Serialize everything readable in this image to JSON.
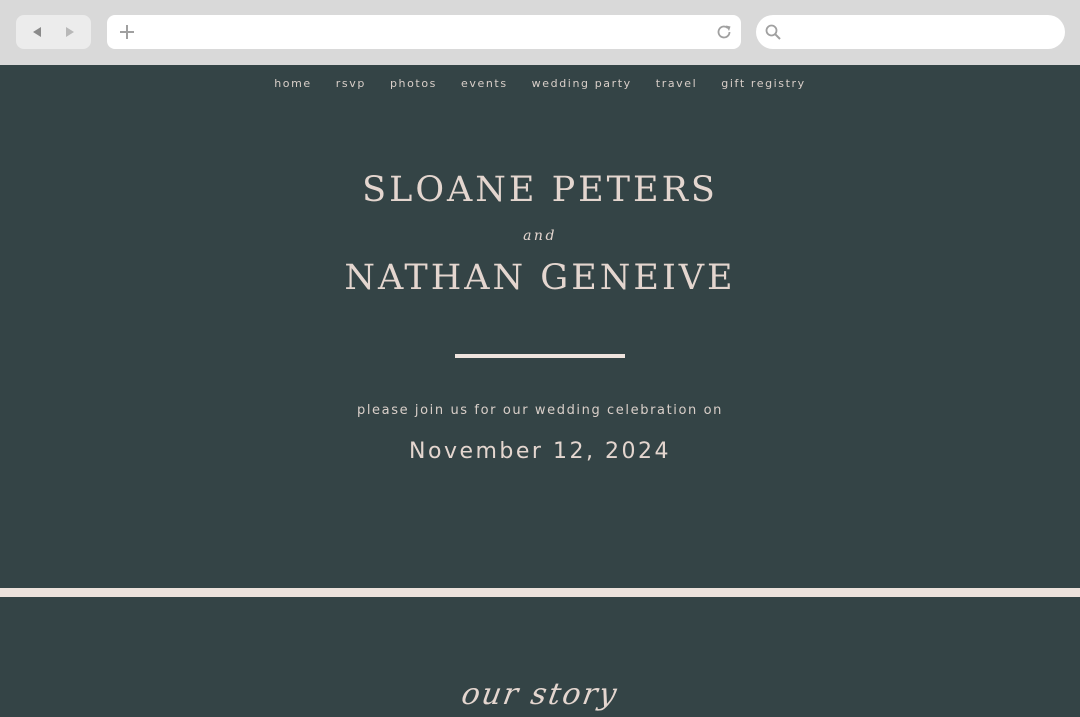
{
  "browser": {
    "back_icon": "triangle-left-icon",
    "forward_icon": "triangle-right-icon",
    "new_tab_icon": "plus-icon",
    "reload_icon": "reload-icon",
    "search_icon": "search-icon"
  },
  "site_nav": {
    "items": [
      {
        "label": "home"
      },
      {
        "label": "rsvp"
      },
      {
        "label": "photos"
      },
      {
        "label": "events"
      },
      {
        "label": "wedding party"
      },
      {
        "label": "travel"
      },
      {
        "label": "gift registry"
      }
    ]
  },
  "hero": {
    "name_one": "SLOANE PETERS",
    "connector": "and",
    "name_two": "NATHAN GENEIVE",
    "invite_line": "please join us for our wedding celebration on",
    "date": "November 12, 2024"
  },
  "story": {
    "heading": "our story"
  },
  "colors": {
    "background": "#344446",
    "text": "#e4d6cf",
    "accent_band": "#ece2dc",
    "chrome": "#d9d9d9"
  }
}
